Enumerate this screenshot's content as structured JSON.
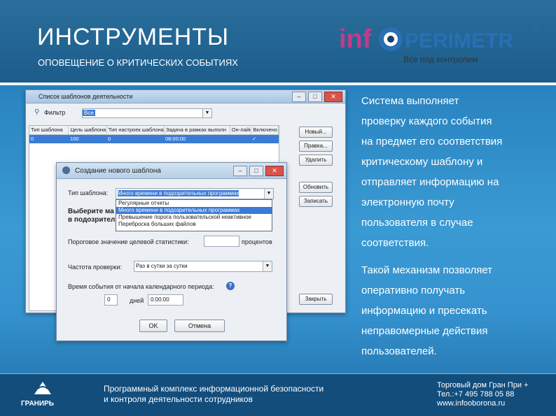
{
  "header": {
    "title": "ИНСТРУМЕНТЫ",
    "subtitle": "ОПОВЕЩЕНИЕ О КРИТИЧЕСКИХ СОБЫТИЯХ",
    "logo_text": "infoPERIMETR",
    "logo_tm": "TM",
    "logo_tagline": "Все под контролем"
  },
  "description": {
    "line1": "Система выполняет",
    "line2": "проверку каждого события",
    "line3": "на предмет его соответствия",
    "line4": "критическому шаблону и",
    "line5": "отправляет информацию на",
    "line6": "электронную почту",
    "line7": "пользователя  в случае",
    "line8": "соответствия.",
    "line9": "Такой механизм позволяет",
    "line10": "оперативно получать",
    "line11": "информацию и пресекать",
    "line12": "неправомерные действия",
    "line13": "пользователей."
  },
  "templates_window": {
    "title": "Список шаблонов деятельности",
    "filter_label": "Фильтр",
    "filter_value": "Все",
    "columns": [
      "Тип шаблона",
      "Цель шаблона",
      "Тип настроек шаблона",
      "Задача в рамках выполн",
      "Он-лайн",
      "Включено"
    ],
    "row": [
      "0",
      "100",
      "0",
      "08:00:00",
      "",
      "✓"
    ],
    "btn_add": "Новый...",
    "btn_edit": "Правка...",
    "btn_delete": "Удалить",
    "btn_refresh": "Обновить",
    "btn_clear": "Записать",
    "btn_close": "Закрыть"
  },
  "create_window": {
    "title": "Создание нового шаблона",
    "type_label": "Тип шаблона:",
    "type_value": "Много времени в подозрительных программах",
    "select_label_1": "Выберите ма",
    "select_label_2": "в подозрител",
    "options": [
      "Регулярные отчеты",
      "Много времени в подозрительных программах",
      "Превышение порога пользовательской неактивное",
      "Переброска больших файлов"
    ],
    "threshold_label": "Пороговое значение целевой статистики:",
    "threshold_unit": "процентов",
    "freq_label": "Частота проверки:",
    "freq_value": "Раз в сутки за сутки",
    "event_time_label": "Время события от начала календарного периода:",
    "days_value": "0",
    "days_unit": "дней",
    "time_value": "0:00:00",
    "ok_label": "OK",
    "cancel_label": "Отмена"
  },
  "footer": {
    "company_logo": "ГРАНИРЬ",
    "product_line1": "Программный комплекс информационной безопасности",
    "product_line2": "и контроля деятельности сотрудников",
    "contact_line1": "Торговый дом Гран При +",
    "contact_line2": "Тел.:+7 495 788 05 88",
    "contact_line3": "www.infooborona.ru"
  }
}
